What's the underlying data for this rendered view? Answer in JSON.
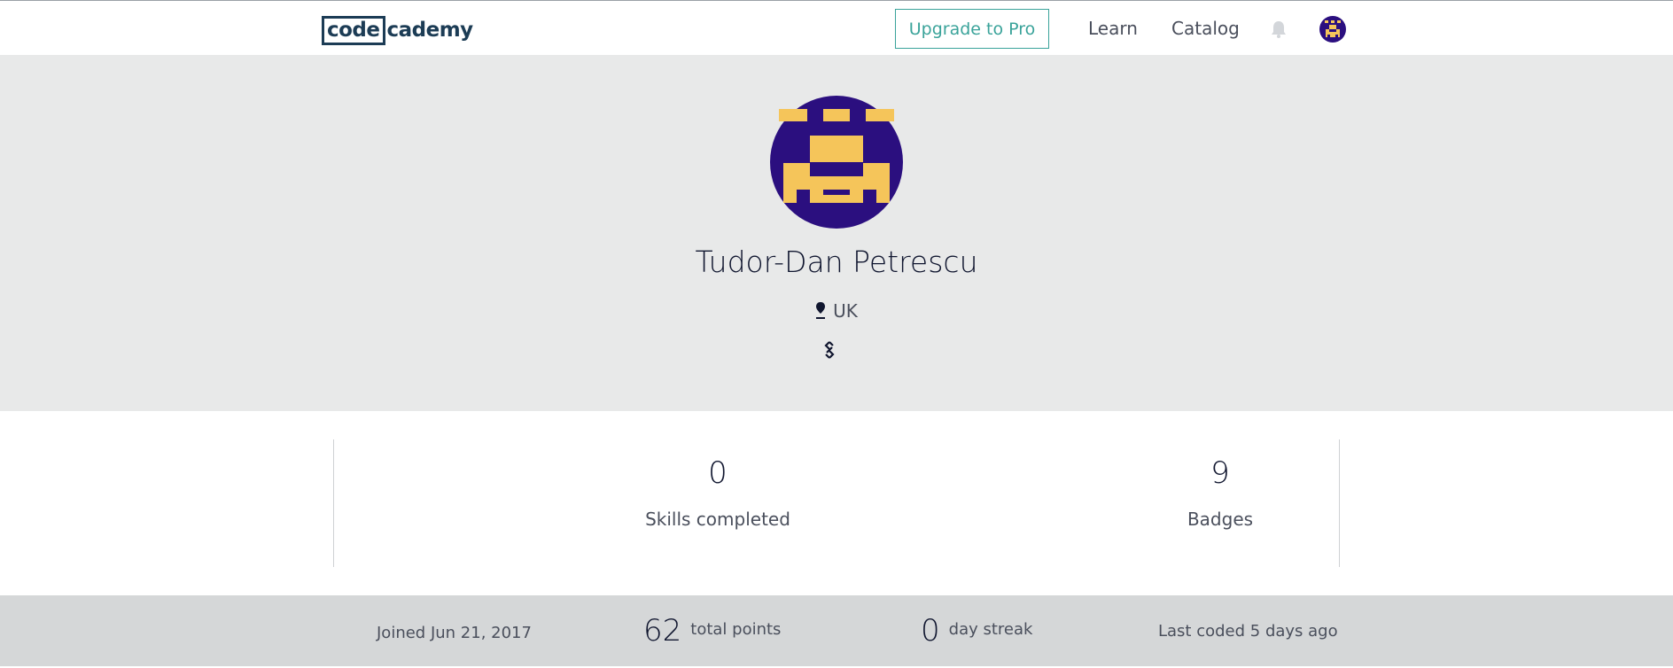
{
  "header": {
    "logo": {
      "boxed": "code",
      "rest": "cademy"
    },
    "upgrade_label": "Upgrade to Pro",
    "nav": {
      "learn": "Learn",
      "catalog": "Catalog"
    },
    "icons": {
      "bell": "bell-icon",
      "avatar": "avatar"
    }
  },
  "profile": {
    "name": "Tudor-Dan Petrescu",
    "location": "UK",
    "icons": {
      "location": "location-pin-icon",
      "link": "link-icon"
    },
    "avatar_colors": {
      "background": "#2b0f7f",
      "pixels": "#f5c55a"
    }
  },
  "stats": [
    {
      "value": "0",
      "label": "Skills completed"
    },
    {
      "value": "9",
      "label": "Badges"
    }
  ],
  "summary": {
    "joined": "Joined Jun 21, 2017",
    "points_value": "62",
    "points_label": "total points",
    "streak_value": "0",
    "streak_label": "day streak",
    "last_coded": "Last coded 5 days ago"
  },
  "colors": {
    "brand": "#1c3c55",
    "accent": "#3aa39a",
    "hero_bg": "#e8e9e9",
    "strip_bg": "#d5d7d8"
  }
}
